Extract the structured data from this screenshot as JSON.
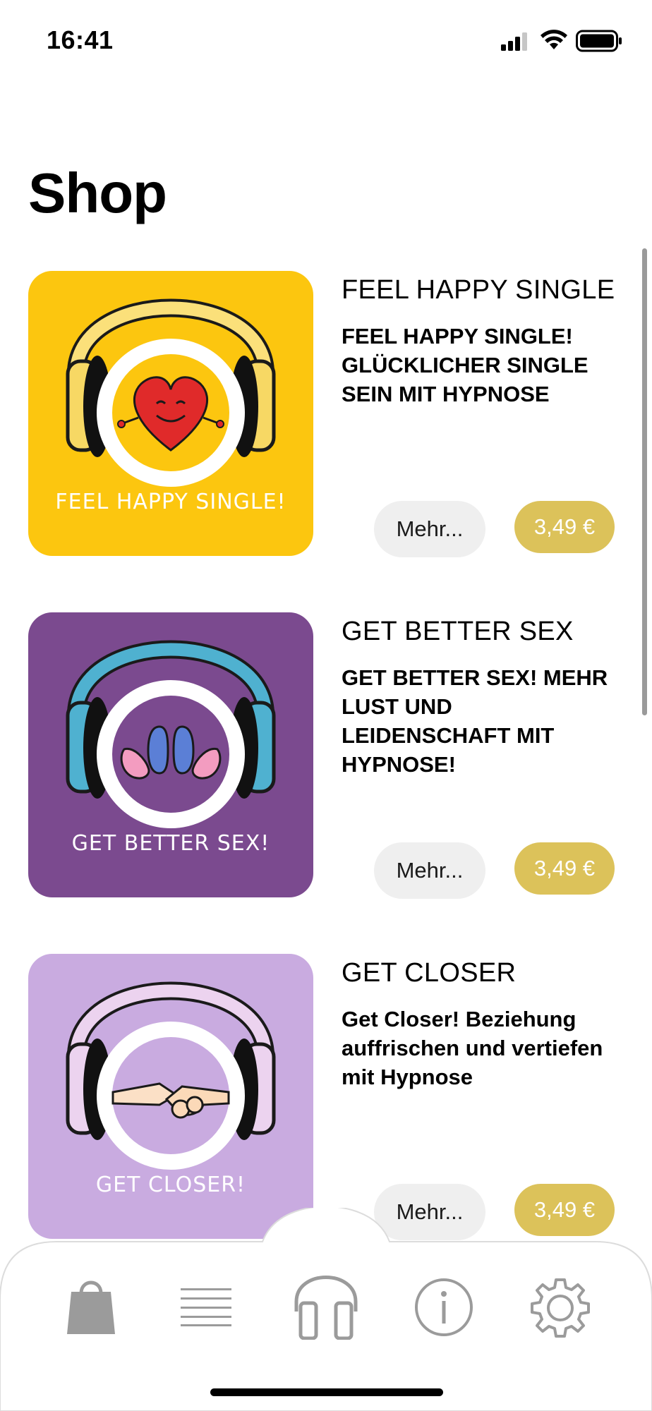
{
  "status_bar": {
    "time": "16:41"
  },
  "page": {
    "title": "Shop"
  },
  "products": [
    {
      "title": "FEEL HAPPY SINGLE",
      "description": "FEEL HAPPY SINGLE! GLÜCKLICHER SINGLE SEIN MIT HYPNOSE",
      "cover_text": "FEEL HAPPY SINGLE!",
      "cover_color": "#fcc60f",
      "more_label": "Mehr...",
      "price": "3,49 €"
    },
    {
      "title": "GET BETTER SEX",
      "description": "GET BETTER SEX! MEHR LUST UND LEIDENSCHAFT MIT HYPNOSE!",
      "cover_text": "GET BETTER SEX!",
      "cover_color": "#7b4a8f",
      "more_label": "Mehr...",
      "price": "3,49 €"
    },
    {
      "title": "GET CLOSER",
      "description": "Get Closer! Beziehung auffrischen und vertiefen mit Hypnose",
      "cover_text": "GET CLOSER!",
      "cover_color": "#c9abe0",
      "more_label": "Mehr...",
      "price": "3,49 €"
    }
  ],
  "tab_bar": {
    "items": [
      {
        "icon": "shopping-bag-icon",
        "active": true
      },
      {
        "icon": "list-icon",
        "active": false
      },
      {
        "icon": "headphones-icon",
        "active": false
      },
      {
        "icon": "info-icon",
        "active": false
      },
      {
        "icon": "gear-icon",
        "active": false
      }
    ]
  },
  "colors": {
    "price_button": "#dcc25a",
    "more_button": "#efefef",
    "tab_icon": "#9b9b9b"
  }
}
